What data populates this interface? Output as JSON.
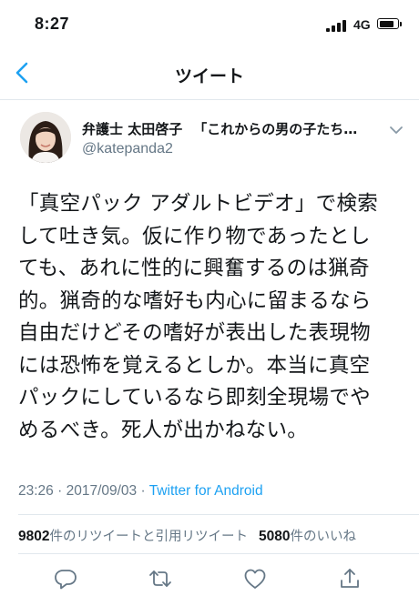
{
  "status_bar": {
    "time": "8:27",
    "network": "4G",
    "signal_bars": 4,
    "battery_level": 0.85
  },
  "nav": {
    "title": "ツイート",
    "back_icon": "chevron-left-icon",
    "accent_color": "#1da1f2"
  },
  "tweet": {
    "author_name": "弁護士 太田啓子",
    "author_bio": "「これからの男の子たち…",
    "handle": "@katepanda2",
    "text_lines": [
      "「真空パック アダルトビデオ」で検索",
      "して吐き気。仮に作り物であったとし",
      "ても、あれに性的に興奮するのは猟奇",
      "的。猟奇的な嗜好も内心に留まるなら",
      "自由だけどその嗜好が表出した表現物",
      "には恐怖を覚えるとしか。本当に真空",
      "パックにしているなら即刻全現場でや",
      "めるべき。死人が出かねない。"
    ],
    "time": "23:26",
    "date": "2017/09/03",
    "separator": "·",
    "client": "Twitter for Android"
  },
  "stats": {
    "retweet_count": "9802",
    "retweet_label": "件のリツイートと引用リツイート",
    "like_count": "5080",
    "like_label": "件のいいね"
  },
  "actions": {
    "icons": [
      "reply-icon",
      "retweet-icon",
      "like-icon",
      "share-icon"
    ],
    "icon_color": "#657786"
  }
}
